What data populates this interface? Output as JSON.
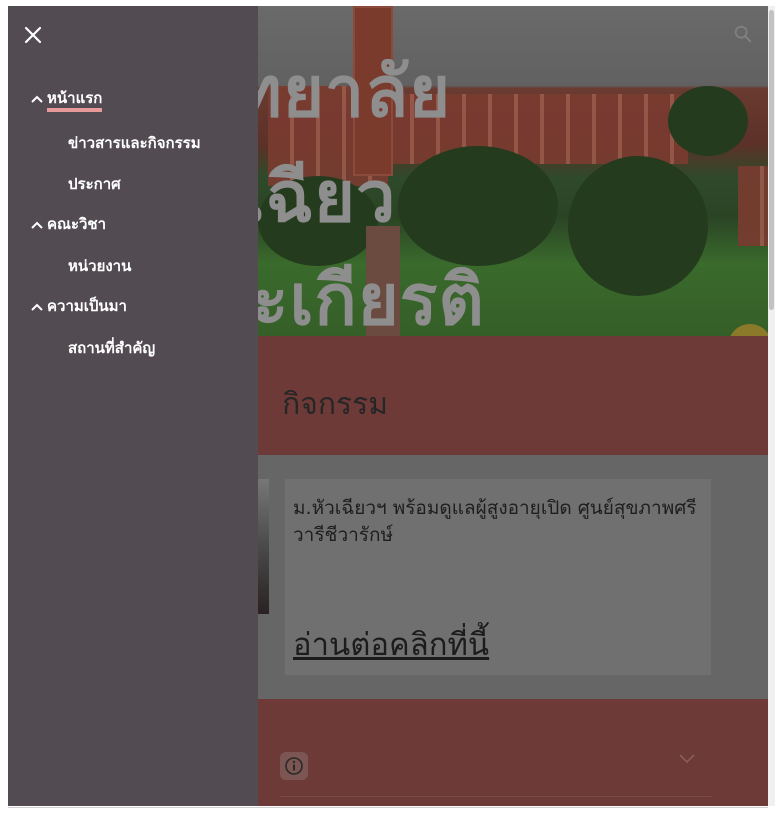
{
  "hero": {
    "title_lines": [
      "หาวิทยาลัย",
      "หัวเฉียว",
      "มพระเกียรติ"
    ],
    "search_icon": "search-icon"
  },
  "news": {
    "heading": "กิจกรรม",
    "card_text": "ม.หัวเฉียวฯ พร้อมดูแลผู้สูงอายุเปิด ศูนย์สุขภาพศรีวารีชีวารักษ์",
    "read_more": "อ่านต่อคลิกที่นี้"
  },
  "footer": {
    "info_icon": "info-icon",
    "chevron_icon": "chevron-down-icon"
  },
  "drawer": {
    "close_icon": "close-icon",
    "items": [
      {
        "label": "หน้าแรก",
        "level": 1,
        "expanded": true,
        "active": true
      },
      {
        "label": "ข่าวสารและกิจกรรม",
        "level": 2
      },
      {
        "label": "ประกาศ",
        "level": 2
      },
      {
        "label": "คณะวิชา",
        "level": 1,
        "expanded": true
      },
      {
        "label": "หน่วยงาน",
        "level": 2
      },
      {
        "label": "ความเป็นมา",
        "level": 1,
        "expanded": true
      },
      {
        "label": "สถานที่สำคัญ",
        "level": 2
      }
    ]
  },
  "colors": {
    "drawer_bg": "#524b52",
    "overlay_brand": "#6e3a38",
    "active_underline": "#e89a9a"
  }
}
